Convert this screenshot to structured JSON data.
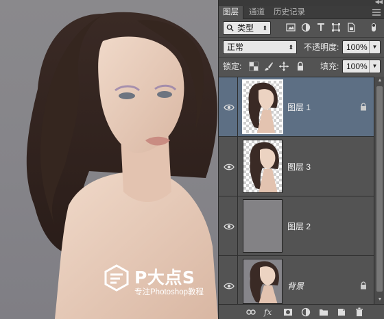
{
  "panel": {
    "tabs": [
      {
        "label": "图层",
        "active": true
      },
      {
        "label": "通道",
        "active": false
      },
      {
        "label": "历史记录",
        "active": false
      }
    ],
    "filter": {
      "kind_label": "类型"
    },
    "blend_mode": "正常",
    "opacity": {
      "label": "不透明度:",
      "value": "100%"
    },
    "lock": {
      "label": "锁定:"
    },
    "fill": {
      "label": "填充:",
      "value": "100%"
    },
    "layers": [
      {
        "name": "图层 1",
        "selected": true,
        "locked": true,
        "thumb": "checker-portrait"
      },
      {
        "name": "图层 3",
        "selected": false,
        "locked": false,
        "thumb": "checker-portrait"
      },
      {
        "name": "图层 2",
        "selected": false,
        "locked": false,
        "thumb": "gray"
      },
      {
        "name": "背景",
        "selected": false,
        "locked": true,
        "thumb": "portrait"
      }
    ],
    "bottom_fx": "fx"
  },
  "watermark": {
    "title": "P大点S",
    "subtitle": "专注Photoshop教程"
  },
  "colors": {
    "panel_bg": "#535353",
    "selected_layer": "#5d6f84",
    "canvas_bg": "#858489"
  }
}
